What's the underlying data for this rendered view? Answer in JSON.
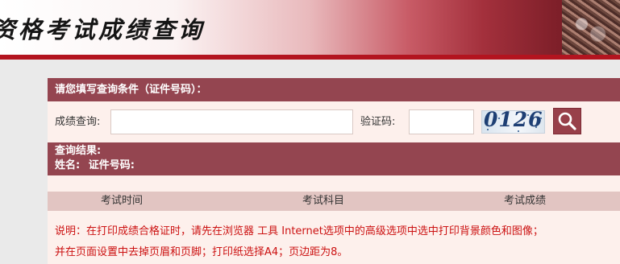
{
  "banner": {
    "title": "资格考试成绩查询"
  },
  "query_header": {
    "title": "请您填写查询条件（证件号码）："
  },
  "form": {
    "score_label": "成绩查询:",
    "score_value": "",
    "captcha_label": "验证码:",
    "captcha_value": "",
    "captcha_image_text": "0126",
    "search_icon": "search-icon"
  },
  "results": {
    "title": "查询结果:",
    "name_label": "姓名:",
    "id_label": "证件号码:"
  },
  "table": {
    "columns": [
      "考试时间",
      "考试科目",
      "考试成绩"
    ]
  },
  "notes": [
    "说明：在打印成绩合格证时，请先在浏览器 工具 Internet选项中的高级选项中选中打印背景颜色和图像；",
    "并在页面设置中去掉页眉和页脚；打印纸选择A4；页边距为8。"
  ],
  "colors": {
    "header_bg": "#944550",
    "panel_bg": "#fdf0ec",
    "accent_red": "#b3141f",
    "note_text": "#cc1111"
  }
}
